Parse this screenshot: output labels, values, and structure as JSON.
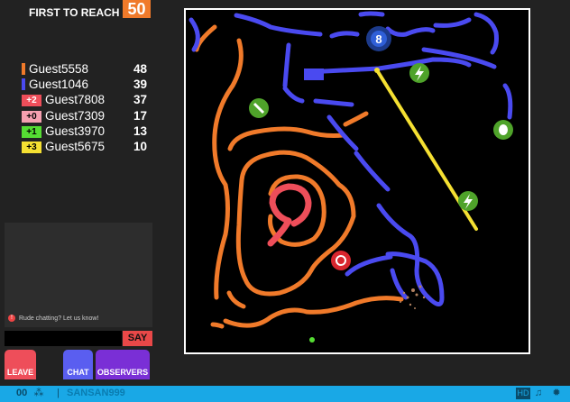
{
  "goal": {
    "label": "FIRST TO REACH",
    "value": "50"
  },
  "scoreboard": [
    {
      "name": "Guest5558",
      "score": "48",
      "color": "#f07a2a",
      "badge": ""
    },
    {
      "name": "Guest1046",
      "score": "39",
      "color": "#4a4af0",
      "badge": ""
    },
    {
      "name": "Guest7808",
      "score": "37",
      "color": "#ee4e5a",
      "badge": "+2"
    },
    {
      "name": "Guest7309",
      "score": "17",
      "color": "#f5a0b0",
      "badge": "+0"
    },
    {
      "name": "Guest3970",
      "score": "13",
      "color": "#55dd33",
      "badge": "+1"
    },
    {
      "name": "Guest5675",
      "score": "10",
      "color": "#f5e032",
      "badge": "+3"
    }
  ],
  "chat": {
    "notice": "Rude chatting? Let us know!",
    "input_value": "",
    "say_label": "SAY"
  },
  "buttons": {
    "leave": "LEAVE",
    "chat": "CHAT",
    "observers": "OBSERVERS"
  },
  "status": {
    "score": "00",
    "separator": "|",
    "username": "SANSAN999"
  },
  "icons": {
    "network": "network-icon",
    "music": "music-icon",
    "bug": "bug-icon"
  },
  "colors": {
    "orange": "#f07a2a",
    "blue": "#4a4af0",
    "red": "#ee4e5a",
    "yellow": "#f5e032",
    "green": "#55dd33",
    "powerup": "#4fa32a"
  }
}
